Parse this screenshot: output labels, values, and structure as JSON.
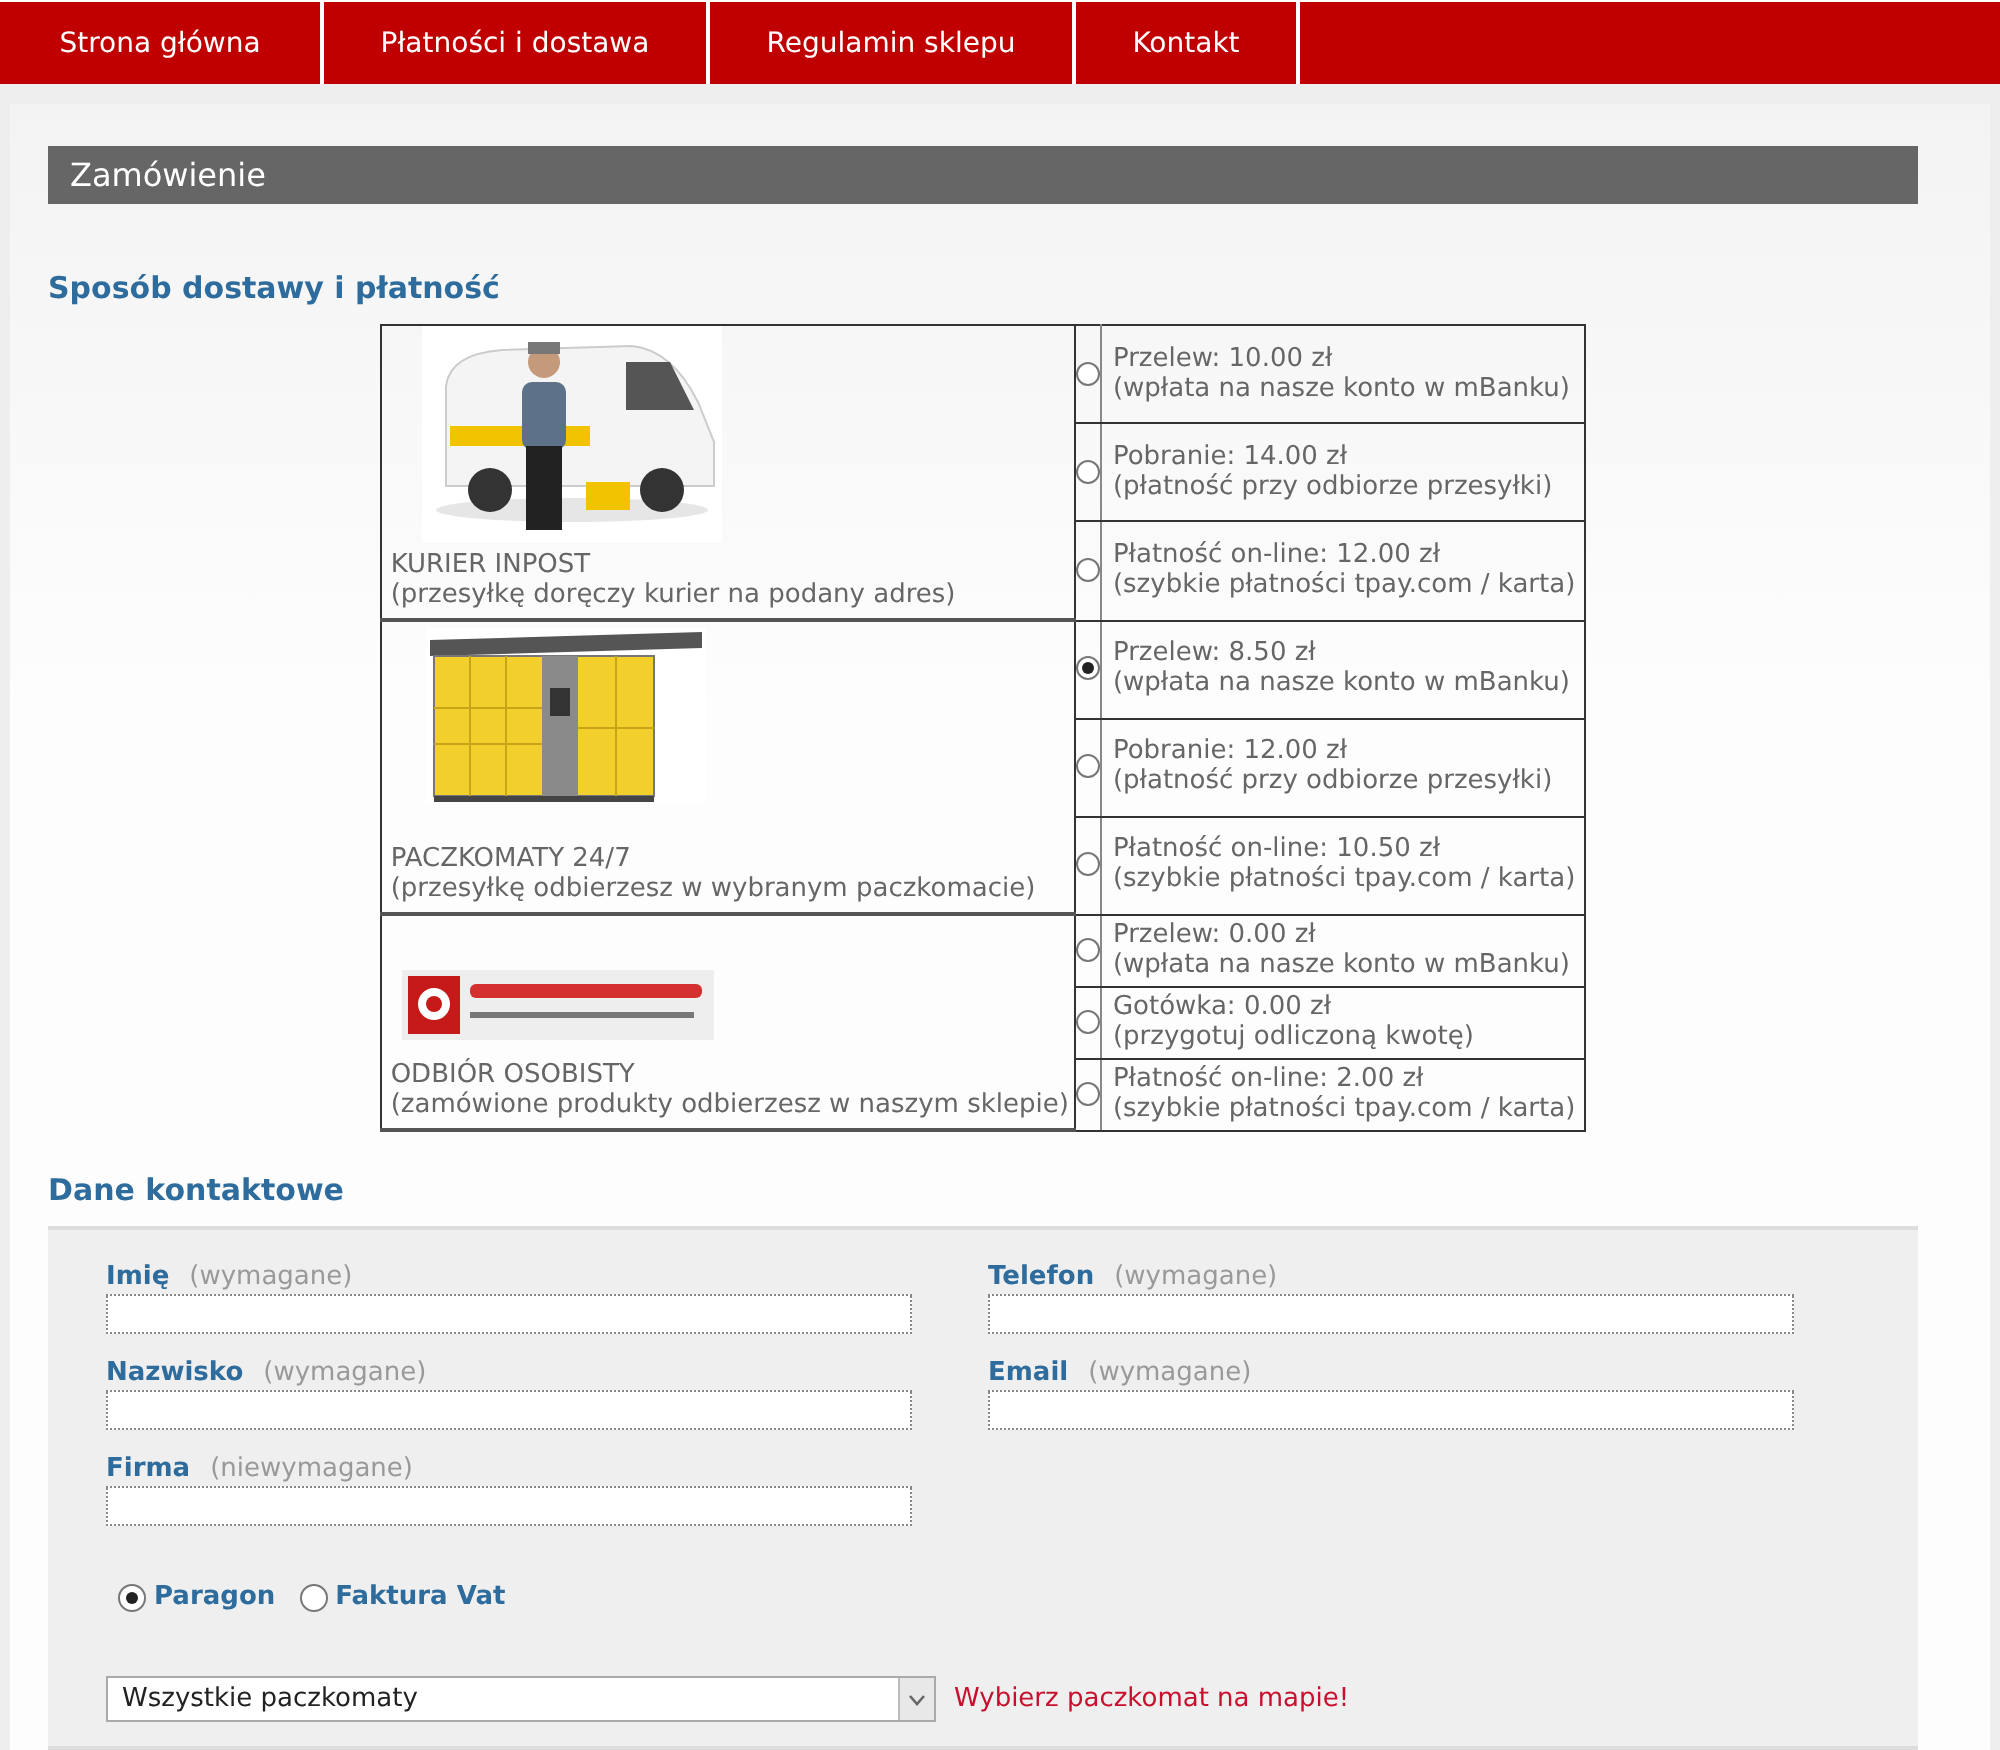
{
  "nav": [
    {
      "label": "Strona główna"
    },
    {
      "label": "Płatności i dostawa"
    },
    {
      "label": "Regulamin sklepu"
    },
    {
      "label": "Kontakt"
    }
  ],
  "header": "Zamówienie",
  "delivery": {
    "heading": "Sposób dostawy i płatność",
    "methods": [
      {
        "kind": "courier",
        "name": "KURIER INPOST",
        "description": "(przesyłkę doręczy kurier na podany adres)",
        "options": [
          {
            "title": "Przelew: 10.00 zł",
            "note": "(wpłata na nasze konto w mBanku)",
            "selected": false
          },
          {
            "title": "Pobranie: 14.00 zł",
            "note": "(płatność przy odbiorze przesyłki)",
            "selected": false
          },
          {
            "title": "Płatność on-line: 12.00 zł",
            "note": "(szybkie płatności tpay.com / karta)",
            "selected": false
          }
        ]
      },
      {
        "kind": "locker",
        "name": "PACZKOMATY 24/7",
        "description": "(przesyłkę odbierzesz w wybranym paczkomacie)",
        "options": [
          {
            "title": "Przelew: 8.50 zł",
            "note": "(wpłata na nasze konto w mBanku)",
            "selected": true
          },
          {
            "title": "Pobranie: 12.00 zł",
            "note": "(płatność przy odbiorze przesyłki)",
            "selected": false
          },
          {
            "title": "Płatność on-line: 10.50 zł",
            "note": "(szybkie płatności tpay.com / karta)",
            "selected": false
          }
        ]
      },
      {
        "kind": "pickup",
        "name": "ODBIÓR OSOBISTY",
        "description": "(zamówione produkty odbierzesz w naszym sklepie)",
        "options": [
          {
            "title": "Przelew: 0.00 zł",
            "note": "(wpłata na nasze konto w mBanku)",
            "selected": false
          },
          {
            "title": "Gotówka: 0.00 zł",
            "note": "(przygotuj odliczoną kwotę)",
            "selected": false
          },
          {
            "title": "Płatność on-line: 2.00 zł",
            "note": "(szybkie płatności tpay.com / karta)",
            "selected": false
          }
        ]
      }
    ]
  },
  "contact": {
    "heading": "Dane kontaktowe",
    "fields": [
      {
        "label": "Imię",
        "hint": "(wymagane)"
      },
      {
        "label": "Telefon",
        "hint": "(wymagane)"
      },
      {
        "label": "Nazwisko",
        "hint": "(wymagane)"
      },
      {
        "label": "Email",
        "hint": "(wymagane)"
      },
      {
        "label": "Firma",
        "hint": "(niewymagane)"
      }
    ],
    "document": [
      {
        "label": "Paragon",
        "selected": true
      },
      {
        "label": "Faktura Vat",
        "selected": false
      }
    ],
    "locker_select": {
      "value": "Wszystkie paczkomaty"
    },
    "map_hint": "Wybierz paczkomat na mapie!"
  }
}
